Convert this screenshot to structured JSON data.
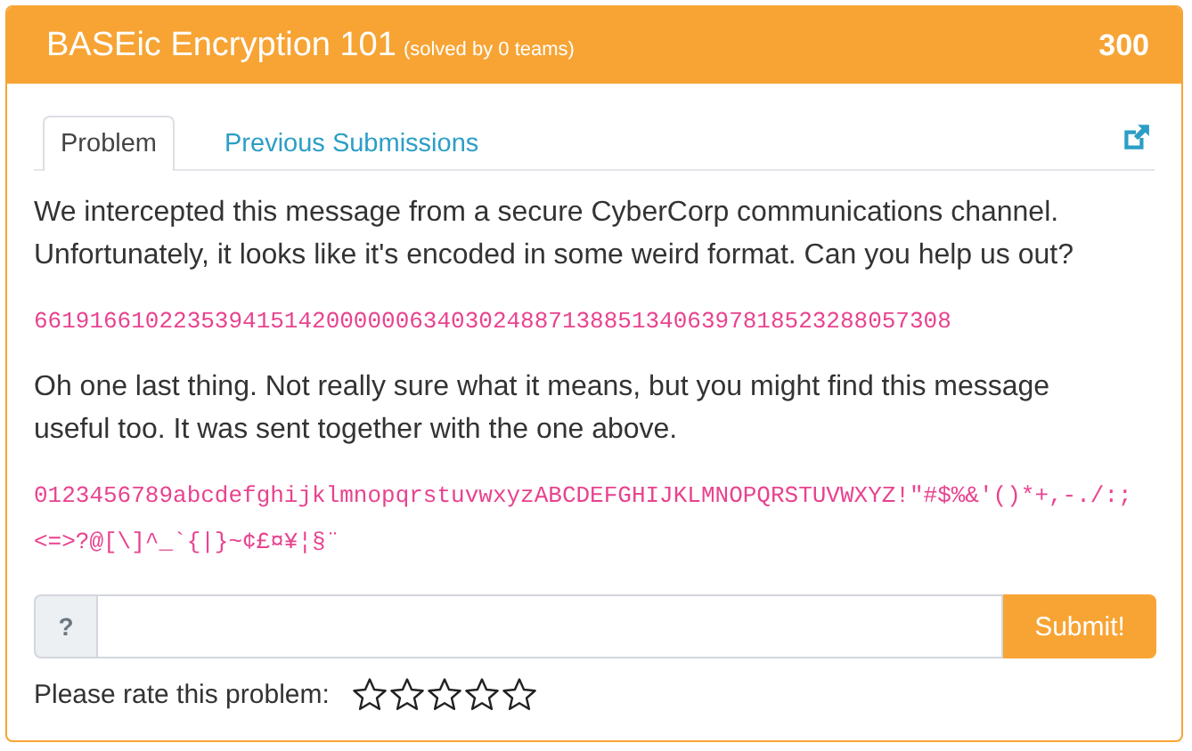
{
  "problem": {
    "title": "BASEic Encryption 101",
    "solved": "(solved by 0 teams)",
    "points": "300"
  },
  "tabs": [
    {
      "label": "Problem",
      "selected": true
    },
    {
      "label": "Previous Submissions",
      "selected": false
    }
  ],
  "content": [
    {
      "kind": "text",
      "text": "We intercepted this message from a secure CyberCorp communications channel. Unfortunately, it looks like it's encoded in some weird format. Can you help us out?"
    },
    {
      "kind": "code",
      "text": "661916610223539415142000000634030248871388513406397818523288057308"
    },
    {
      "kind": "text",
      "text": "Oh one last thing. Not really sure what it means, but you might find this message useful too. It was sent together with the one above."
    },
    {
      "kind": "code",
      "text": "0123456789abcdefghijklmnopqrstuvwxyzABCDEFGHIJKLMNOPQRSTUVWXYZ!\"#$%&'()*+,-./:;<=>?@[\\]^_`{|}~¢£¤¥¦§¨"
    }
  ],
  "answer": {
    "prefix": "?",
    "button": "Submit!"
  },
  "rating": {
    "label": "Please rate this problem:",
    "stars": 0
  }
}
